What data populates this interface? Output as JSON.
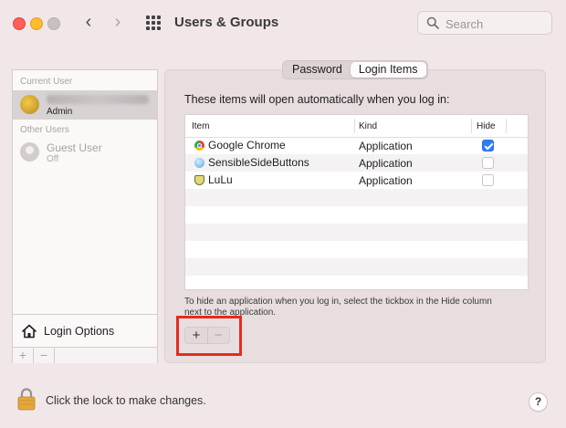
{
  "window": {
    "title": "Users & Groups"
  },
  "search": {
    "placeholder": "Search"
  },
  "sidebar": {
    "current_user_header": "Current User",
    "current_user": {
      "role": "Admin"
    },
    "other_users_header": "Other Users",
    "guest": {
      "name": "Guest User",
      "status": "Off"
    },
    "login_options_label": "Login Options",
    "add_label": "+",
    "remove_label": "−"
  },
  "tabs": [
    {
      "label": "Password",
      "active": false
    },
    {
      "label": "Login Items",
      "active": true
    }
  ],
  "main": {
    "intro": "These items will open automatically when you log in:",
    "columns": {
      "item": "Item",
      "kind": "Kind",
      "hide": "Hide"
    },
    "items": [
      {
        "name": "Google Chrome",
        "kind": "Application",
        "hide": true,
        "icon": "chrome-icon"
      },
      {
        "name": "SensibleSideButtons",
        "kind": "Application",
        "hide": false,
        "icon": "sensible-side-buttons-icon"
      },
      {
        "name": "LuLu",
        "kind": "Application",
        "hide": false,
        "icon": "lulu-icon"
      }
    ],
    "hint_line1": "To hide an application when you log in, select the tickbox in the Hide column",
    "hint_line2": "next to the application.",
    "add_label": "+",
    "remove_label": "−"
  },
  "footer": {
    "lock_text": "Click the lock to make changes.",
    "help_label": "?"
  },
  "colors": {
    "window_bg": "#f1e7e8",
    "panel_bg": "#e9dedf",
    "checkbox_checked": "#2f7cf6",
    "highlight": "#e52b1e"
  }
}
